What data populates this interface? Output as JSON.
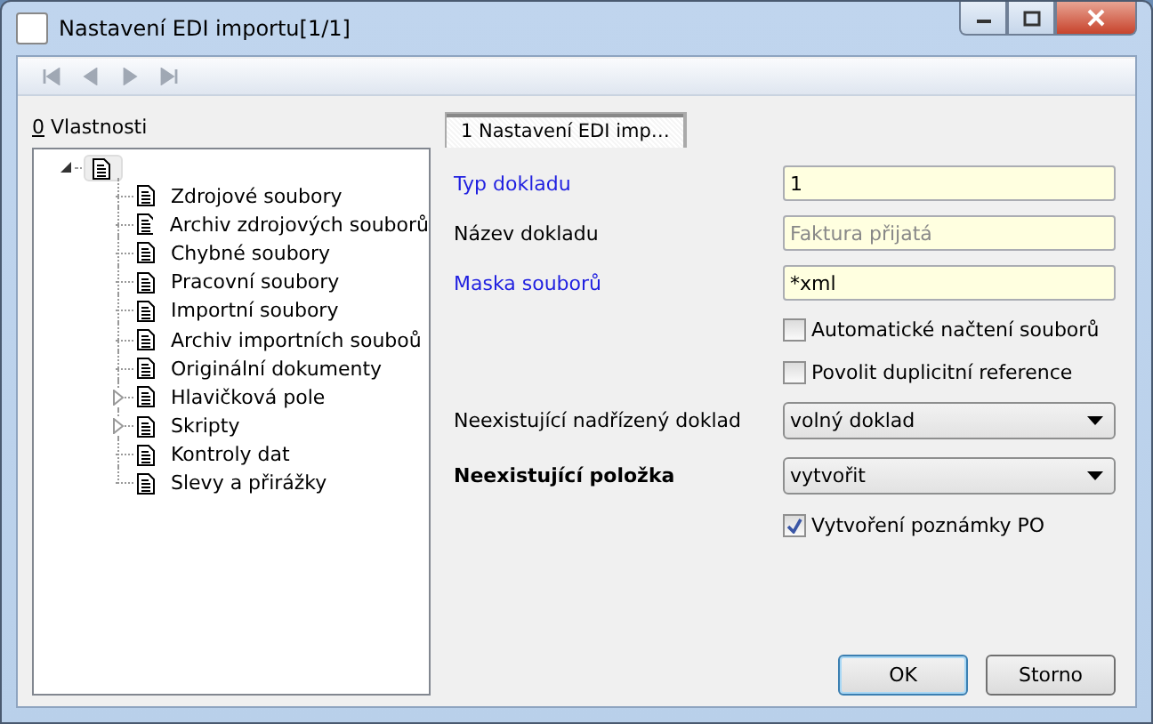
{
  "window": {
    "title": "Nastavení EDI importu[1/1]"
  },
  "toolbar": {
    "buttons": [
      {
        "kind": "first",
        "disabled": true
      },
      {
        "kind": "prev",
        "disabled": true
      },
      {
        "kind": "next",
        "disabled": true
      },
      {
        "kind": "last",
        "disabled": true
      }
    ]
  },
  "properties_panel": {
    "label_mnemonic": "0",
    "label": " Vlastnosti",
    "tree": {
      "expanded": true,
      "children": [
        {
          "label": "Zdrojové soubory",
          "expandable": false
        },
        {
          "label": "Archiv zdrojových souborů",
          "expandable": false
        },
        {
          "label": "Chybné soubory",
          "expandable": false
        },
        {
          "label": "Pracovní soubory",
          "expandable": false
        },
        {
          "label": "Importní soubory",
          "expandable": false
        },
        {
          "label": "Archiv importních souboů",
          "expandable": false
        },
        {
          "label": "Originální dokumenty",
          "expandable": false
        },
        {
          "label": "Hlavičková pole",
          "expandable": true
        },
        {
          "label": "Skripty",
          "expandable": true
        },
        {
          "label": "Kontroly dat",
          "expandable": false
        },
        {
          "label": "Slevy a přirážky",
          "expandable": false
        }
      ]
    }
  },
  "tabs": [
    {
      "label": "1 Nastavení EDI imp…",
      "selected": true
    }
  ],
  "form": [
    {
      "kind": "text",
      "label": "Typ dokladu",
      "required": true,
      "bold": false,
      "value": "1",
      "disabled": false
    },
    {
      "kind": "text",
      "label": "Název dokladu",
      "required": false,
      "bold": false,
      "value": "Faktura přijatá",
      "disabled": true
    },
    {
      "kind": "text",
      "label": "Maska souborů",
      "required": true,
      "bold": false,
      "value": "*xml",
      "disabled": false
    },
    {
      "kind": "checkbox",
      "label": "Automatické načtení souborů",
      "checked": false
    },
    {
      "kind": "checkbox",
      "label": "Povolit duplicitní reference",
      "checked": false
    },
    {
      "kind": "select",
      "label": "Neexistující nadřízený doklad",
      "required": false,
      "bold": false,
      "value": "volný doklad"
    },
    {
      "kind": "select",
      "label": "Neexistující položka",
      "required": false,
      "bold": true,
      "value": "vytvořit"
    },
    {
      "kind": "checkbox",
      "label": "Vytvoření poznámky PO",
      "checked": true
    }
  ],
  "buttons": [
    {
      "label": "OK",
      "default": true
    },
    {
      "label": "Storno",
      "default": false
    }
  ]
}
